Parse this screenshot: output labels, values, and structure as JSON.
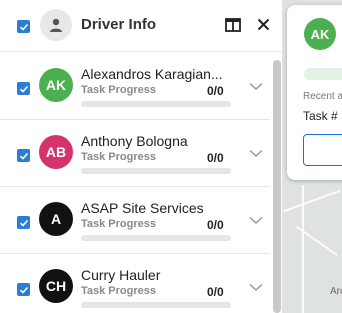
{
  "header": {
    "title": "Driver Info",
    "select_all_checked": true
  },
  "drivers": [
    {
      "initials": "AK",
      "name": "Alexandros Karagian...",
      "task_label": "Task Progress",
      "task_count": "0/0",
      "avatar_color": "#4caf50",
      "checked": true
    },
    {
      "initials": "AB",
      "name": "Anthony Bologna",
      "task_label": "Task Progress",
      "task_count": "0/0",
      "avatar_color": "#d6336c",
      "checked": true
    },
    {
      "initials": "A",
      "name": "ASAP Site Services",
      "task_label": "Task Progress",
      "task_count": "0/0",
      "avatar_color": "#111111",
      "checked": true
    },
    {
      "initials": "CH",
      "name": "Curry Hauler",
      "task_label": "Task Progress",
      "task_count": "0/0",
      "avatar_color": "#111111",
      "checked": true
    }
  ],
  "detail_card": {
    "initials": "AK",
    "avatar_color": "#4caf50",
    "recent_label": "Recent a",
    "task_label": "Task #"
  },
  "map": {
    "label": "Arc"
  },
  "colors": {
    "checkbox": "#2a7fd4",
    "accent": "#1976d2"
  }
}
